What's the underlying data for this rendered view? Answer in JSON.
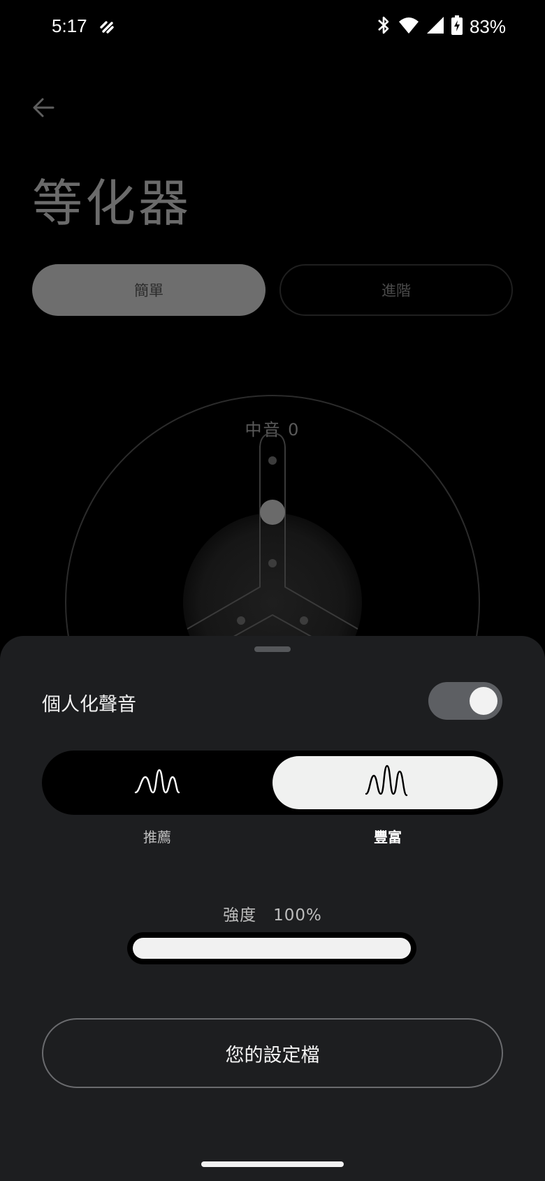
{
  "status_bar": {
    "time": "5:17",
    "battery_percent": "83%",
    "icons": [
      "app-notification-icon",
      "bluetooth-icon",
      "wifi-icon",
      "signal-icon",
      "battery-charging-icon"
    ]
  },
  "header": {
    "back_icon": "arrow-left-icon",
    "title": "等化器"
  },
  "tabs": {
    "simple": "簡單",
    "advanced": "進階",
    "selected": "simple"
  },
  "equalizer": {
    "label": "中音 0",
    "value": 0
  },
  "sheet": {
    "personal_sound_label": "個人化聲音",
    "personal_sound_enabled": true,
    "options": [
      {
        "label": "推薦",
        "icon": "wave-recommend-icon",
        "selected": false
      },
      {
        "label": "豐富",
        "icon": "wave-rich-icon",
        "selected": true
      }
    ],
    "intensity_label": "強度　100%",
    "intensity_value": 1.0,
    "profile_button": "您的設定檔"
  },
  "colors": {
    "background": "#000000",
    "sheet": "#1d1e20",
    "selected_pill": "#f0f1f0",
    "tab_selected": "#6e6e6e"
  }
}
